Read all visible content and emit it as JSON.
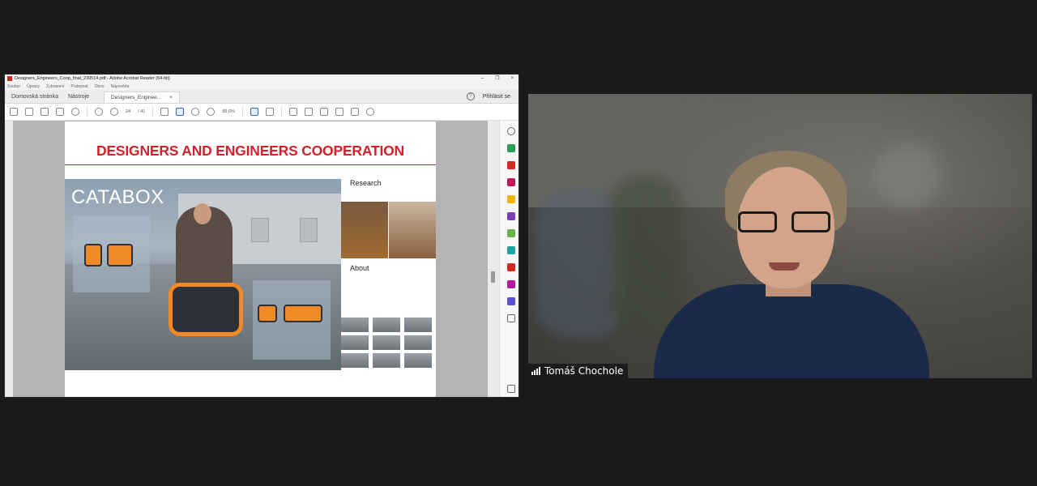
{
  "acrobat": {
    "window_title": "Designers_Engineers_Coop_final_230514.pdf - Adobe Acrobat Reader (64-bit)",
    "window_controls": [
      "?",
      "–",
      "❐",
      "×"
    ],
    "menu": [
      "Soubor",
      "Úpravy",
      "Zobrazení",
      "Podepsat",
      "Okno",
      "Nápověda"
    ],
    "tabs": {
      "home": "Domovská stránka",
      "tools": "Nástroje",
      "document": "Designers_Enginee...",
      "close": "×"
    },
    "sign_in": "Přihlásit se",
    "page_indicator": {
      "current": "24",
      "total": "/ 41"
    },
    "zoom": "89,6%",
    "pdf_page": {
      "title": "DESIGNERS AND ENGINEERS COOPERATION",
      "hero_title": "CATABOX",
      "research_heading": "Research",
      "about_heading": "About"
    }
  },
  "video": {
    "participant_name": "Tomáš Chochole"
  },
  "colors": {
    "pdf_title_red": "#d61f2b",
    "catabox_orange": "#f08a26",
    "meeting_bg": "#1a1a1a"
  }
}
